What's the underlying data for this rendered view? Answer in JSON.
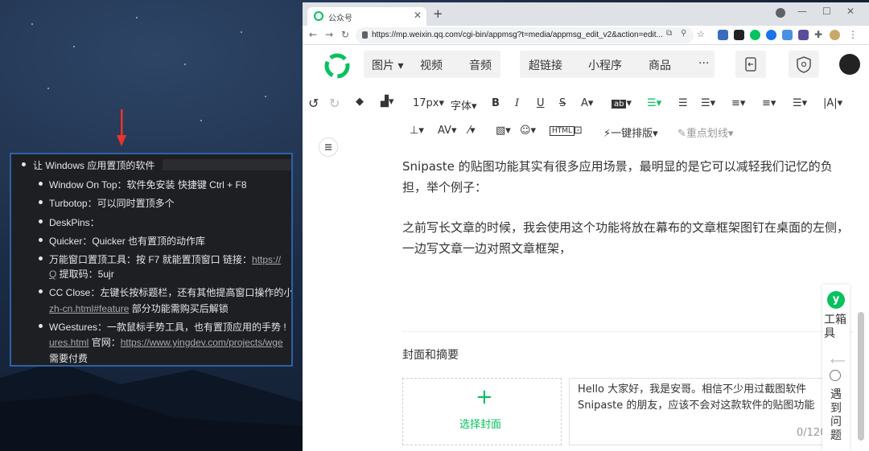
{
  "snippet": {
    "lines": [
      {
        "text": "让 Windows 应用置顶的软件"
      },
      {
        "text": "Window On Top：软件免安装 快捷键 Ctrl + F8"
      },
      {
        "text": "Turbotop：可以同时置顶多个"
      },
      {
        "text": "DeskPins："
      },
      {
        "text": "Quicker：Quicker 也有置顶的动作库"
      },
      {
        "text": "万能窗口置顶工具：按 F7 就能置顶窗口   链接：",
        "link": "https://"
      },
      {
        "link": "Q",
        "text": "  提取码：5ujr"
      },
      {
        "text": "CC Close：左键长按标题栏，还有其他提高窗口操作的小"
      },
      {
        "link": "zh-cn.html#feature",
        "text": "  部分功能需购买后解锁"
      },
      {
        "text": "WGestures：一款鼠标手势工具，也有置顶应用的手势  !"
      },
      {
        "link": "ures.html",
        "text": "   官网：",
        "link2": "https://www.yingdev.com/projects/wge"
      },
      {
        "text": "需要付费"
      }
    ]
  },
  "browser": {
    "tab_title": "公众号",
    "tab_close": "✕",
    "new_tab": "+",
    "window_controls": [
      "—",
      "☐",
      "✕"
    ],
    "url": "https://mp.weixin.qq.com/cgi-bin/appmsg?t=media/appmsg_edit_v2&action=edit..."
  },
  "menu": {
    "group1": [
      "图片",
      "视频",
      "音频"
    ],
    "group2": [
      "超链接",
      "小程序",
      "商品",
      "···"
    ]
  },
  "toolbar": {
    "font_size": "17px",
    "font": "字体",
    "bold": "B",
    "italic": "I",
    "underline": "U",
    "strike": "S",
    "font_color": "A",
    "one_key_layout": "一键排版",
    "highlight": "重点划线"
  },
  "content": {
    "para1": "Snipaste 的贴图功能其实有很多应用场景，最明显的是它可以减轻我们记忆的负担，举个例子：",
    "para2": "之前写长文章的时候，我会使用这个功能将放在幕布的文章框架图钉在桌面的左侧，一边写文章一边对照文章框架，",
    "cover_section": "封面和摘要",
    "choose_cover": "选择封面",
    "summary": "Hello 大家好，我是安哥。相信不少用过截图软件 Snipaste 的朋友，应该不会对这款软件的贴图功能",
    "counter": "0/120"
  },
  "sidebar": {
    "toolbox": "工箱具",
    "problem": "遇到问题"
  },
  "colors": {
    "wechat_green": "#07c160",
    "selection_border": "#2e61a6"
  }
}
